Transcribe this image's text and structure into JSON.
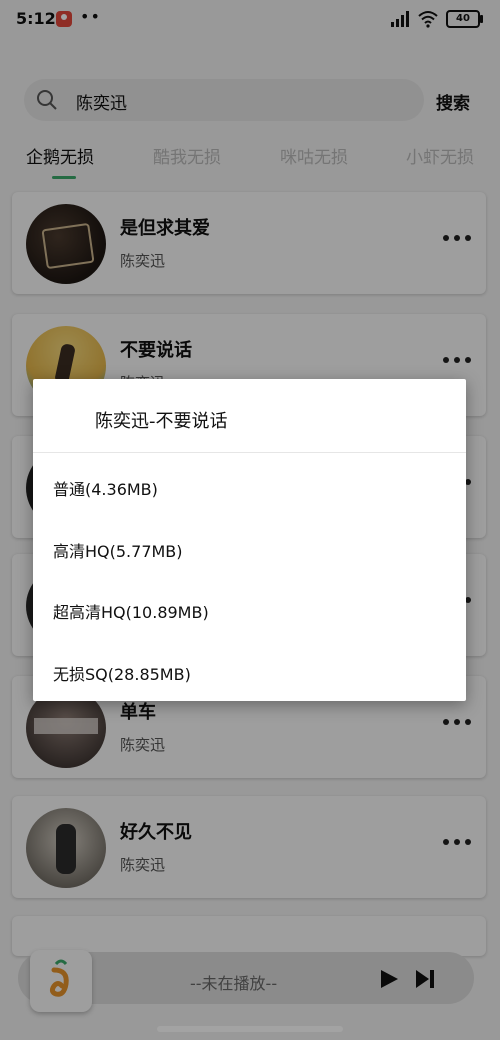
{
  "status_bar": {
    "time": "5:12",
    "dots": "••",
    "battery": "40",
    "icons": [
      "location-app-icon",
      "signal-icon",
      "wifi-icon",
      "battery-icon"
    ]
  },
  "search": {
    "value": "陈奕迅",
    "button_label": "搜索"
  },
  "tabs": [
    {
      "label": "企鹅无损",
      "active": true
    },
    {
      "label": "酷我无损",
      "active": false
    },
    {
      "label": "咪咕无损",
      "active": false
    },
    {
      "label": "小虾无损",
      "active": false
    }
  ],
  "songs": [
    {
      "title": "是但求其爱",
      "artist": "陈奕迅"
    },
    {
      "title": "不要说话",
      "artist": "陈奕迅"
    },
    {
      "title": "单车",
      "artist": "陈奕迅"
    },
    {
      "title": "好久不见",
      "artist": "陈奕迅"
    }
  ],
  "player": {
    "status": "--未在播放--"
  },
  "dialog": {
    "title": "陈奕迅-不要说话",
    "options": [
      "普通(4.36MB)",
      "高清HQ(5.77MB)",
      "超高清HQ(10.89MB)",
      "无损SQ(28.85MB)"
    ]
  },
  "colors": {
    "accent": "#3aa86a",
    "background": "#efefef",
    "card": "#f7f7f7"
  }
}
